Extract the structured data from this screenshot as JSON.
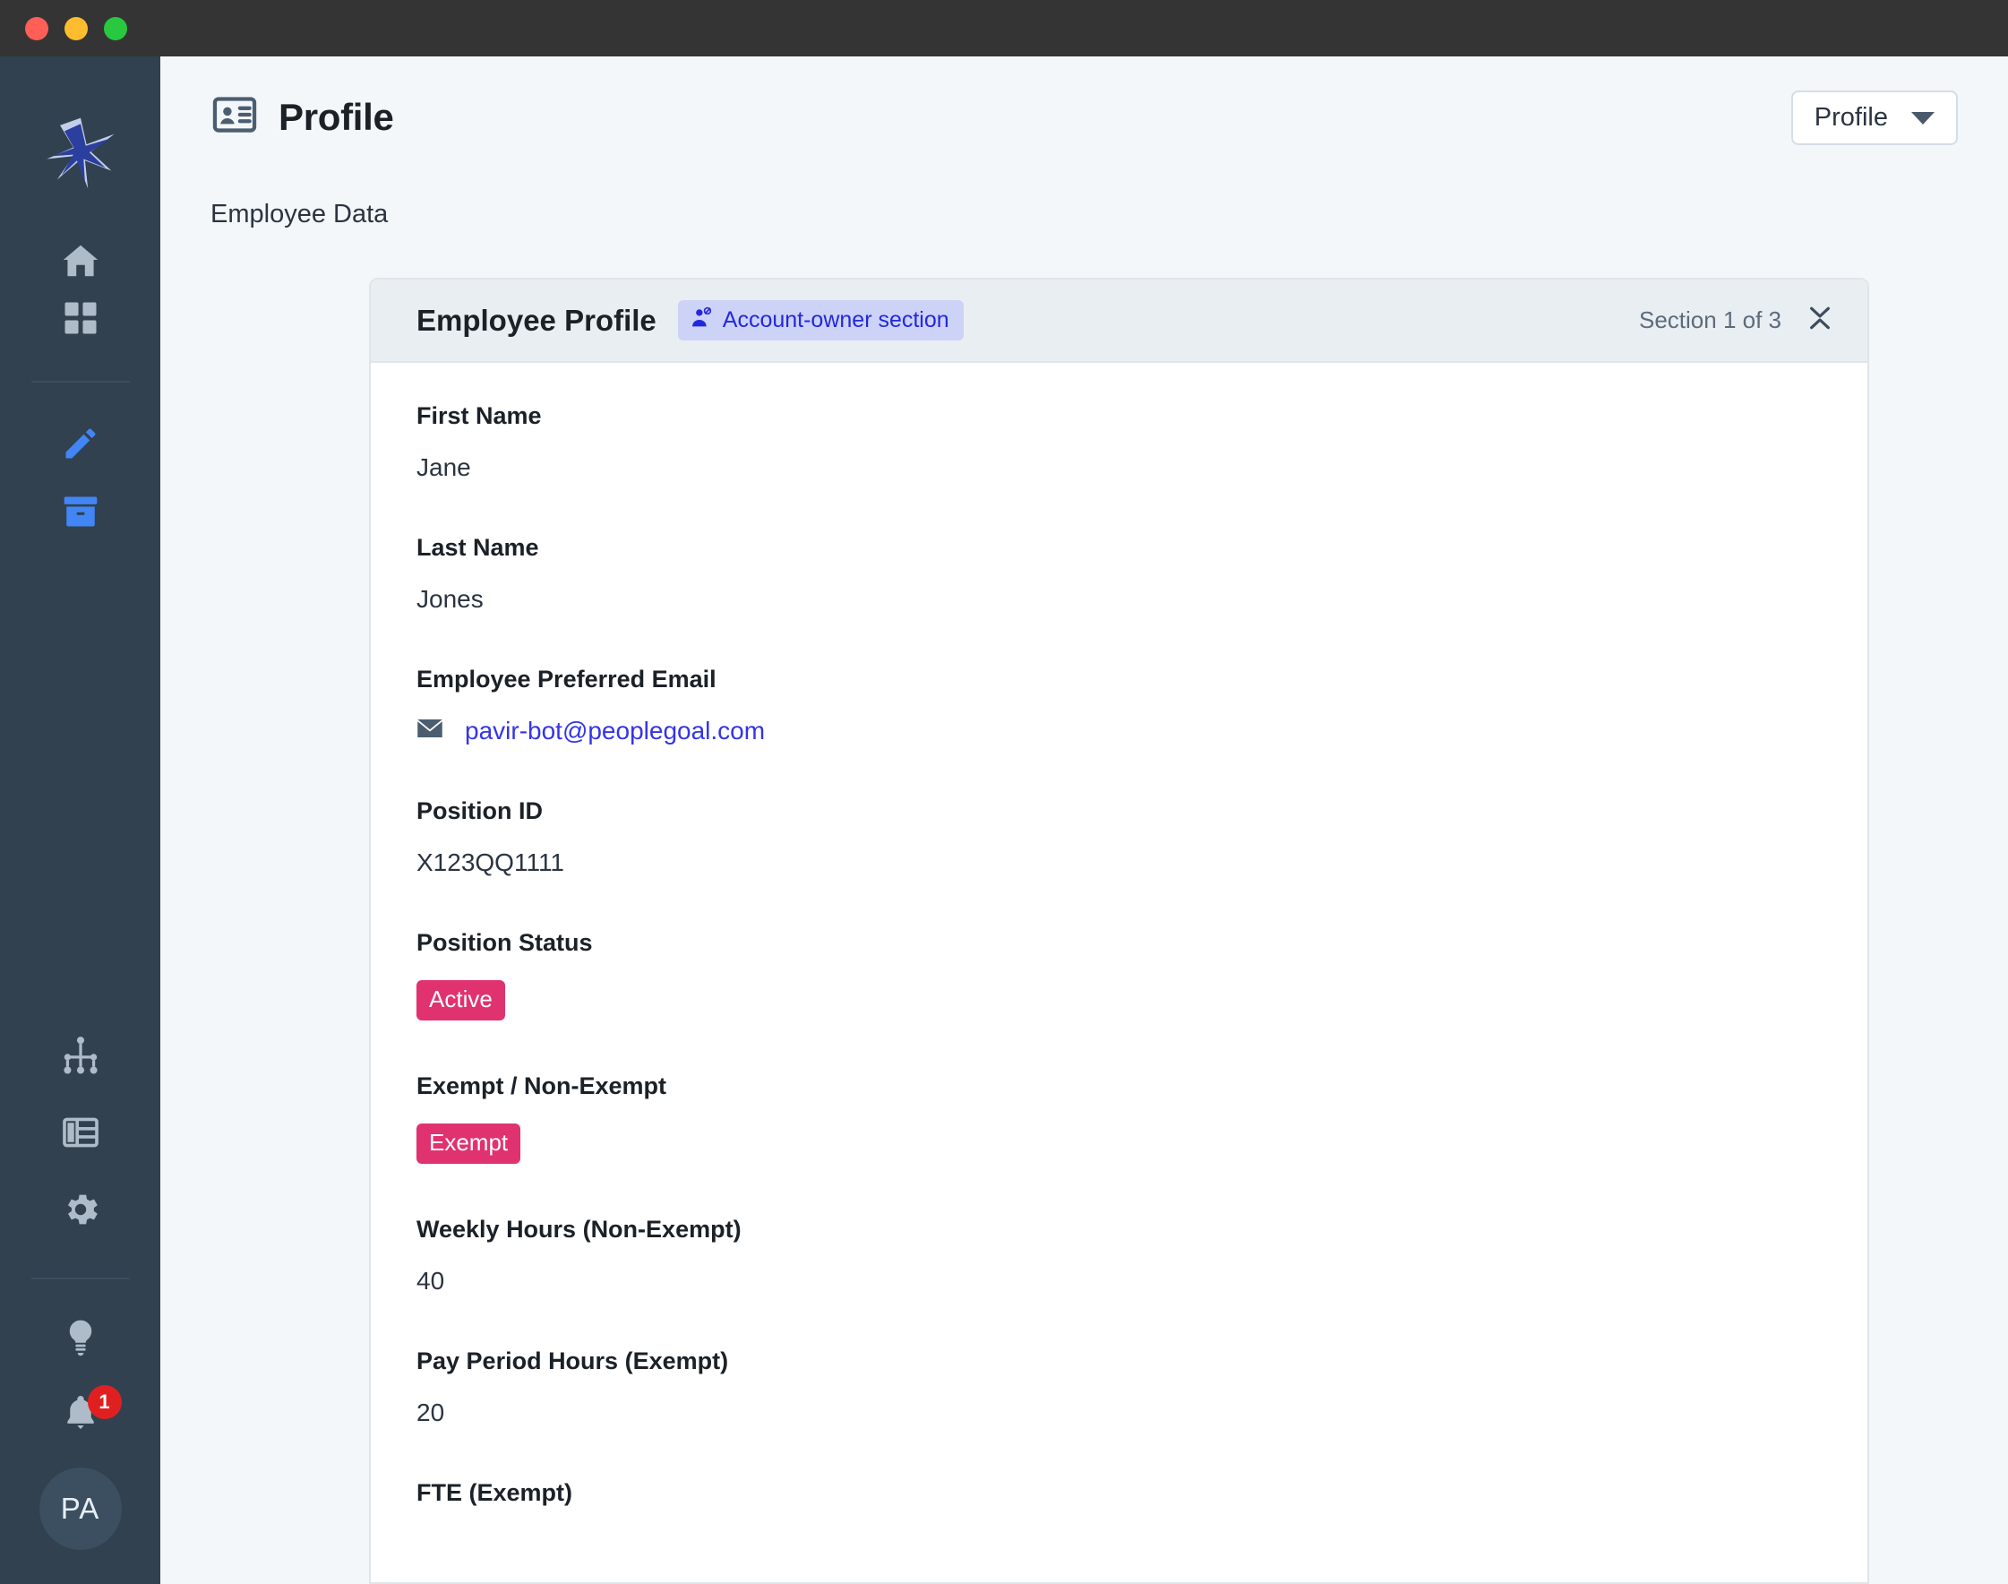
{
  "window": {
    "traffic_lights": [
      "close",
      "minimize",
      "zoom"
    ]
  },
  "sidebar": {
    "logo": "starburst-logo",
    "items": [
      {
        "icon": "home-icon",
        "name": "home"
      },
      {
        "icon": "grid-apps-icon",
        "name": "apps"
      },
      {
        "icon": "pencil-edit-icon",
        "name": "edit"
      },
      {
        "icon": "archive-box-icon",
        "name": "archive"
      },
      {
        "icon": "org-chart-icon",
        "name": "org-chart"
      },
      {
        "icon": "table-view-icon",
        "name": "table-view"
      },
      {
        "icon": "gear-settings-icon",
        "name": "settings"
      },
      {
        "icon": "lightbulb-icon",
        "name": "ideas"
      },
      {
        "icon": "bell-notifications-icon",
        "name": "notifications"
      }
    ],
    "notification_count": "1",
    "avatar_initials": "PA"
  },
  "header": {
    "icon": "id-card-icon",
    "title": "Profile",
    "subtitle": "Employee Data",
    "dropdown": {
      "label": "Profile",
      "icon": "chevron-down-icon"
    }
  },
  "card": {
    "title": "Employee Profile",
    "owner_badge": {
      "label": "Account-owner section",
      "icon": "user-shield-icon"
    },
    "section_count": "Section 1 of 3",
    "collapse_icon": "collapse-chevrons-icon",
    "fields": [
      {
        "label": "First Name",
        "value": "Jane",
        "type": "text"
      },
      {
        "label": "Last Name",
        "value": "Jones",
        "type": "text"
      },
      {
        "label": "Employee Preferred Email",
        "value": "pavir-bot@peoplegoal.com",
        "type": "email"
      },
      {
        "label": "Position ID",
        "value": "X123QQ1111",
        "type": "text"
      },
      {
        "label": "Position Status",
        "value": "Active",
        "type": "pill"
      },
      {
        "label": "Exempt / Non-Exempt",
        "value": "Exempt",
        "type": "pill"
      },
      {
        "label": "Weekly Hours (Non-Exempt)",
        "value": "40",
        "type": "text"
      },
      {
        "label": "Pay Period Hours (Exempt)",
        "value": "20",
        "type": "text"
      },
      {
        "label": "FTE (Exempt)",
        "value": "",
        "type": "text"
      }
    ]
  },
  "colors": {
    "sidebar_bg": "#31414f",
    "titlebar_bg": "#343434",
    "page_bg": "#f4f7fa",
    "card_head_bg": "#e9eef2",
    "accent_pink": "#e0326e",
    "accent_blue": "#3434e8",
    "badge_lavender": "#cdd2f7",
    "notification_red": "#e02020",
    "nav_active_blue": "#4285f4"
  }
}
